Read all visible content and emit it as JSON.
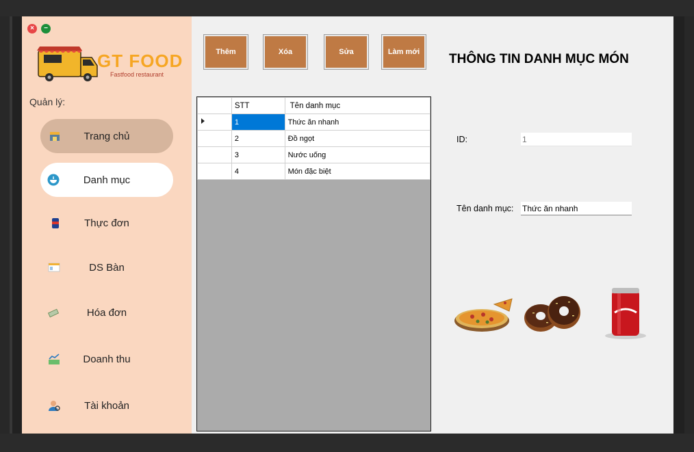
{
  "window": {
    "close_glyph": "×",
    "minimize_glyph": "−"
  },
  "logo": {
    "title": "GT FOOD",
    "subtitle": "Fastfood restaurant"
  },
  "sidebar": {
    "manage_label": "Quản lý:",
    "items": [
      {
        "label": "Trang chủ",
        "icon": "home-store-icon",
        "state": "hover"
      },
      {
        "label": "Danh mục",
        "icon": "food-bowl-icon",
        "state": "active"
      },
      {
        "label": "Thực đơn",
        "icon": "soda-can-icon",
        "state": "normal"
      },
      {
        "label": "DS Bàn",
        "icon": "table-list-icon",
        "state": "normal"
      },
      {
        "label": "Hóa đơn",
        "icon": "cash-bill-icon",
        "state": "normal"
      },
      {
        "label": "Doanh thu",
        "icon": "revenue-chart-icon",
        "state": "normal"
      },
      {
        "label": "Tài khoản",
        "icon": "user-account-icon",
        "state": "normal"
      }
    ]
  },
  "toolbar": {
    "add_label": "Thêm",
    "delete_label": "Xóa",
    "edit_label": "Sửa",
    "refresh_label": "Làm mới"
  },
  "grid": {
    "columns": [
      "STT",
      "Tên danh mục"
    ],
    "rows": [
      {
        "stt": "1",
        "name": "Thức ăn nhanh"
      },
      {
        "stt": "2",
        "name": "Đồ ngọt"
      },
      {
        "stt": "3",
        "name": "Nước uống"
      },
      {
        "stt": "4",
        "name": "Món đặc biệt"
      }
    ]
  },
  "panel": {
    "title": "THÔNG TIN DANH MỤC MÓN",
    "id_label": "ID:",
    "id_value": "1",
    "name_label": "Tên danh mục:",
    "name_value": "Thức ăn nhanh"
  },
  "colors": {
    "sidebar_bg": "#fad7c0",
    "button_bg": "#bf7a44",
    "selection": "#0078d7",
    "logo_accent": "#f6a623"
  }
}
